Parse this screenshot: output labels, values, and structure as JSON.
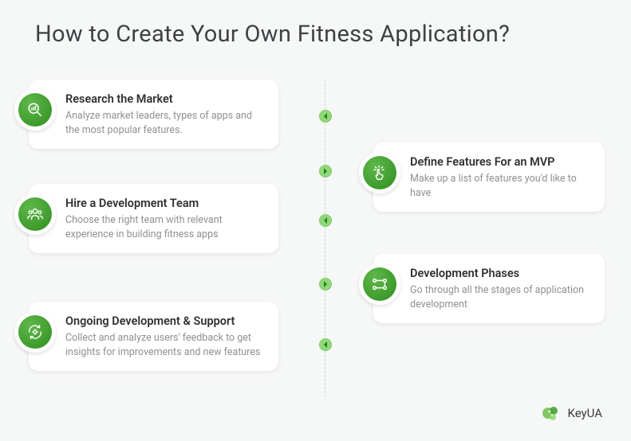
{
  "title": "How to Create Your Own Fitness Application?",
  "steps": [
    {
      "title": "Research the Market",
      "desc": "Analyze market leaders, types of apps and the most popular features.",
      "icon": "magnifier-chart-icon"
    },
    {
      "title": "Define Features For an MVP",
      "desc": "Make up a list of features you'd like to have",
      "icon": "tap-features-icon"
    },
    {
      "title": "Hire a Development Team",
      "desc": "Choose the right team with relevant experience in building fitness apps",
      "icon": "team-icon"
    },
    {
      "title": "Development Phases",
      "desc": "Go through all the stages of application development",
      "icon": "flow-icon"
    },
    {
      "title": "Ongoing Development & Support",
      "desc": "Collect and analyze users' feedback to get insights for improvements and new features",
      "icon": "gear-cycle-icon"
    }
  ],
  "brand": {
    "name": "KeyUA"
  }
}
